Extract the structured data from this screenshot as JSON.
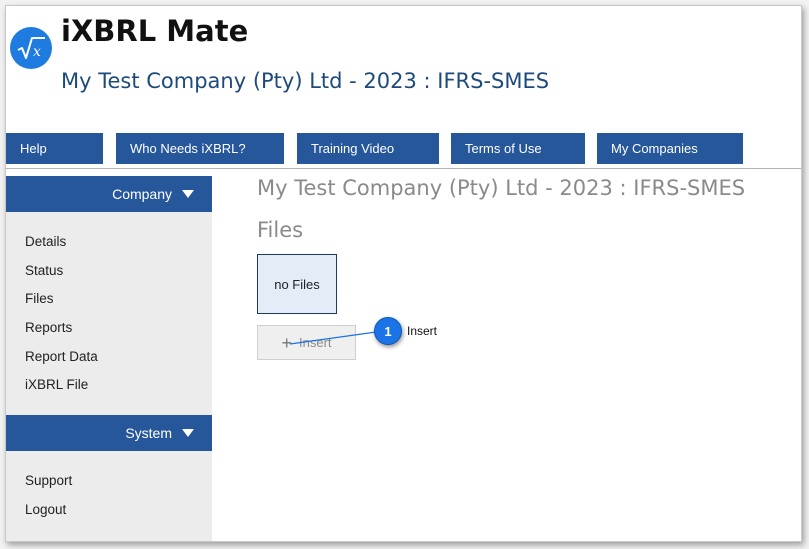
{
  "app": {
    "title": "iXBRL Mate",
    "company_title": "My Test Company (Pty) Ltd - 2023 : IFRS-SMES",
    "logo_icon": "sqrt-x-icon",
    "accent_color": "#26579a"
  },
  "nav": {
    "items": [
      {
        "label": "Help"
      },
      {
        "label": "Who Needs iXBRL?"
      },
      {
        "label": "Training Video"
      },
      {
        "label": "Terms of Use"
      },
      {
        "label": "My Companies"
      }
    ]
  },
  "sidebar": {
    "company_header": "Company",
    "company_items": [
      "Details",
      "Status",
      "Files",
      "Reports",
      "Report Data",
      "iXBRL File"
    ],
    "system_header": "System",
    "system_items": [
      "Support",
      "Logout"
    ]
  },
  "main": {
    "title": "My Test Company (Pty) Ltd - 2023 : IFRS-SMES",
    "section_heading": "Files",
    "empty_text": "no Files",
    "insert_label": "Insert",
    "insert_icon": "plus-icon"
  },
  "callout": {
    "number": "1",
    "label": "Insert",
    "color": "#1a74e8"
  }
}
